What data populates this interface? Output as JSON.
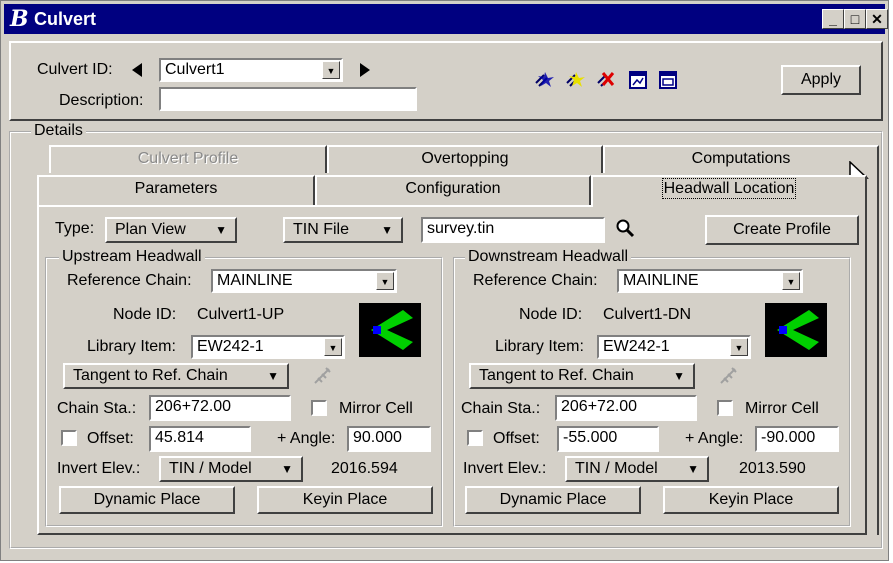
{
  "window": {
    "title": "Culvert",
    "app_icon": "bentley-b-icon"
  },
  "header": {
    "culvert_id_label": "Culvert ID:",
    "culvert_id_value": "Culvert1",
    "description_label": "Description:",
    "description_value": "",
    "tool_icons": [
      "add-culvert-icon",
      "copy-culvert-icon",
      "delete-culvert-icon",
      "view-profile-icon",
      "report-icon"
    ],
    "apply_label": "Apply"
  },
  "details": {
    "label": "Details",
    "tabs_back": [
      "Culvert Profile",
      "Overtopping",
      "Computations"
    ],
    "tabs_front": [
      "Parameters",
      "Configuration",
      "Headwall Location"
    ],
    "active_tab": "Headwall Location"
  },
  "headwall": {
    "type_label": "Type:",
    "type_value": "Plan View",
    "surface_value": "TIN File",
    "tin_file": "survey.tin",
    "create_profile_label": "Create Profile",
    "upstream": {
      "title": "Upstream Headwall",
      "ref_chain_label": "Reference Chain:",
      "ref_chain_value": "MAINLINE",
      "node_id_label": "Node ID:",
      "node_id_value": "Culvert1-UP",
      "library_label": "Library Item:",
      "library_value": "EW242-1",
      "orientation_value": "Tangent to Ref. Chain",
      "chain_sta_label": "Chain Sta.:",
      "chain_sta_value": "206+72.00",
      "mirror_label": "Mirror Cell",
      "offset_label": "Offset:",
      "offset_value": "45.814",
      "angle_label": "+ Angle:",
      "angle_value": "90.000",
      "invert_label": "Invert Elev.:",
      "invert_method": "TIN / Model",
      "invert_value": "2016.594",
      "dynamic_label": "Dynamic Place",
      "keyin_label": "Keyin Place"
    },
    "downstream": {
      "title": "Downstream Headwall",
      "ref_chain_label": "Reference Chain:",
      "ref_chain_value": "MAINLINE",
      "node_id_label": "Node ID:",
      "node_id_value": "Culvert1-DN",
      "library_label": "Library Item:",
      "library_value": "EW242-1",
      "orientation_value": "Tangent to Ref. Chain",
      "chain_sta_label": "Chain Sta.:",
      "chain_sta_value": "206+72.00",
      "mirror_label": "Mirror Cell",
      "offset_label": "Offset:",
      "offset_value": "-55.000",
      "angle_label": "+ Angle:",
      "angle_value": "-90.000",
      "invert_label": "Invert Elev.:",
      "invert_method": "TIN / Model",
      "invert_value": "2013.590",
      "dynamic_label": "Dynamic Place",
      "keyin_label": "Keyin Place"
    }
  },
  "colors": {
    "title_bar": "#000080",
    "dialog_bg": "#d4d0c8",
    "cell_green": "#00d000",
    "cell_blue": "#0000ff"
  }
}
